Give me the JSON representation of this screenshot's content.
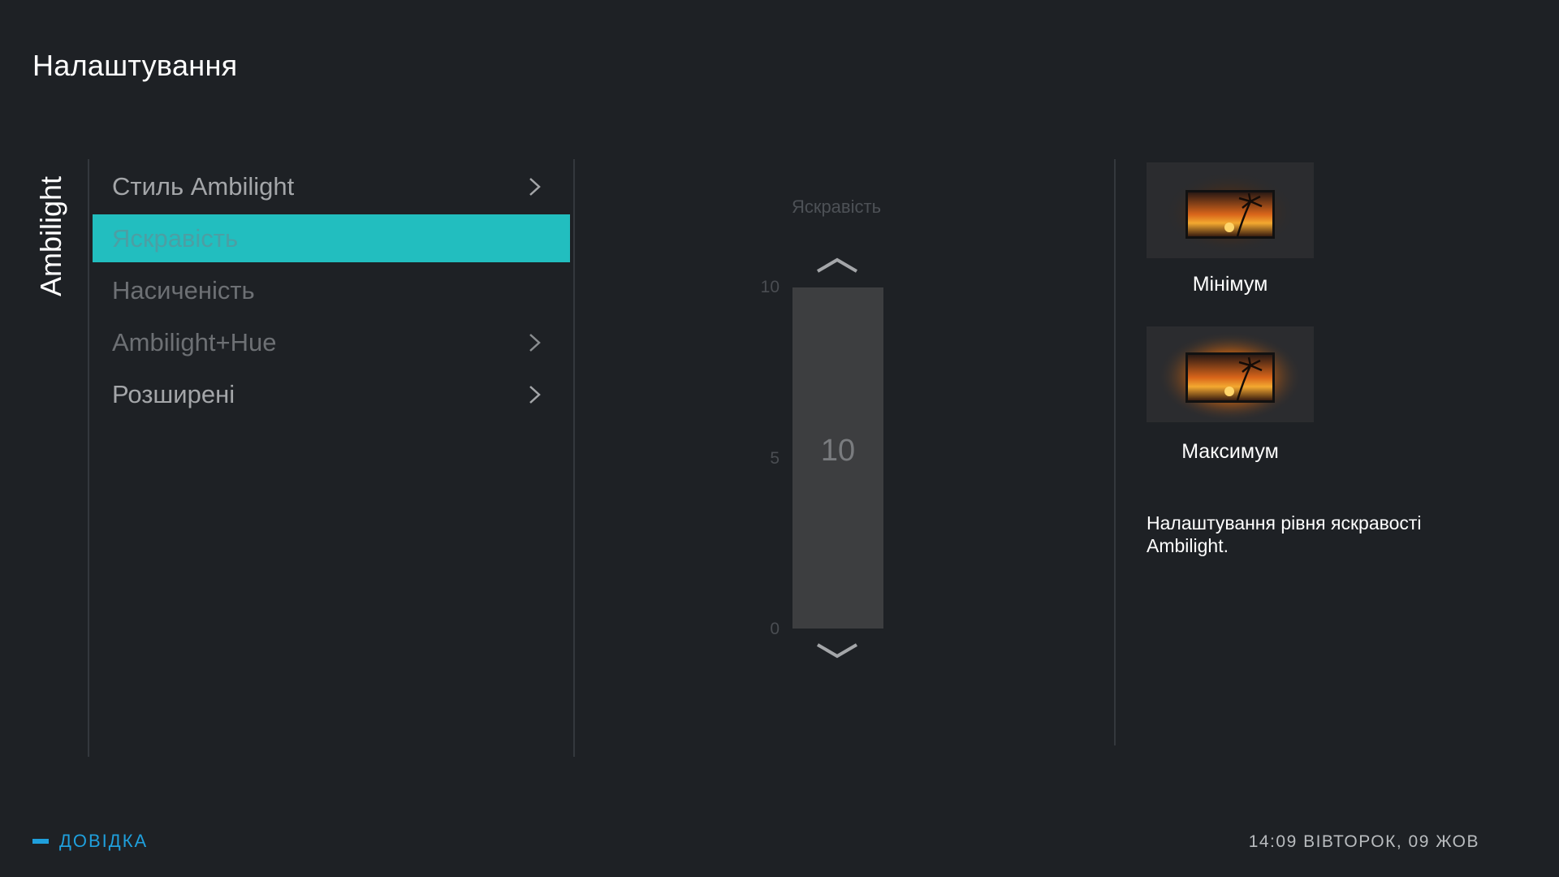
{
  "header": {
    "title": "Налаштування"
  },
  "category": {
    "label": "Ambilight"
  },
  "menu": {
    "items": [
      {
        "label": "Стиль Ambilight",
        "has_submenu": true,
        "state": "normal"
      },
      {
        "label": "Яскравість",
        "has_submenu": false,
        "state": "selected"
      },
      {
        "label": "Насиченість",
        "has_submenu": false,
        "state": "dimmed"
      },
      {
        "label": "Ambilight+Hue",
        "has_submenu": true,
        "state": "dimmed"
      },
      {
        "label": "Розширені",
        "has_submenu": true,
        "state": "normal"
      }
    ]
  },
  "slider": {
    "label": "Яскравість",
    "value": "10",
    "ticks": {
      "max": "10",
      "mid": "5",
      "min": "0"
    }
  },
  "previews": {
    "min_label": "Мінімум",
    "max_label": "Максимум"
  },
  "help_text": "Налаштування рівня яскравості Ambilight.",
  "footer": {
    "help_label": "ДОВІДКА",
    "clock": "14:09 ВІВТОРОК, 09 ЖОВ"
  },
  "colors": {
    "background": "#1e2125",
    "accent": "#22bebf",
    "help": "#1f9fdc"
  }
}
